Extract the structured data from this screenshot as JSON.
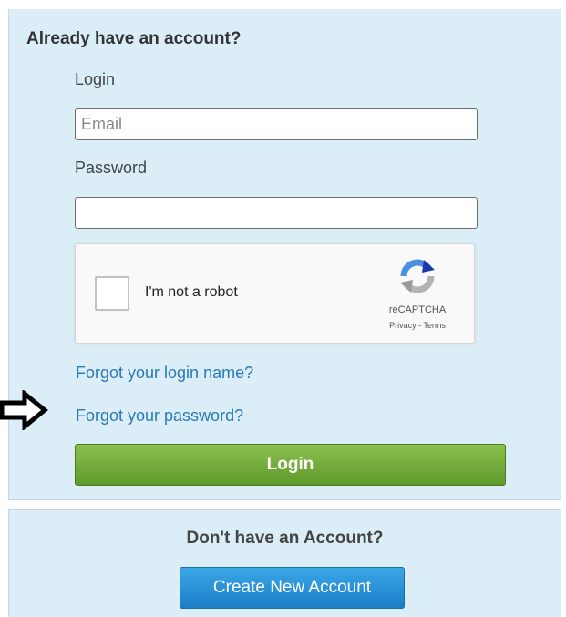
{
  "login_panel": {
    "title": "Already have an account?",
    "login_label": "Login",
    "email_placeholder": "Email",
    "email_value": "",
    "password_label": "Password",
    "password_value": "",
    "captcha": {
      "label": "I'm not a robot",
      "brand": "reCAPTCHA",
      "links": "Privacy - Terms",
      "logo_icon": "recaptcha-logo-icon",
      "colors": {
        "blue": "#4a90e2",
        "dark_blue": "#1c3aa9",
        "gray": "#b3b3b3"
      }
    },
    "forgot_login_link": "Forgot your login name?",
    "forgot_password_link": "Forgot your password?",
    "annotation_icon": "right-arrow-icon",
    "login_button": "Login"
  },
  "signup_panel": {
    "title": "Don't have an Account?",
    "create_button": "Create New Account"
  },
  "colors": {
    "panel_background": "#dbeef8",
    "link": "#2a7ab8",
    "login_button": "#6ea83a",
    "create_button": "#2891d8"
  }
}
